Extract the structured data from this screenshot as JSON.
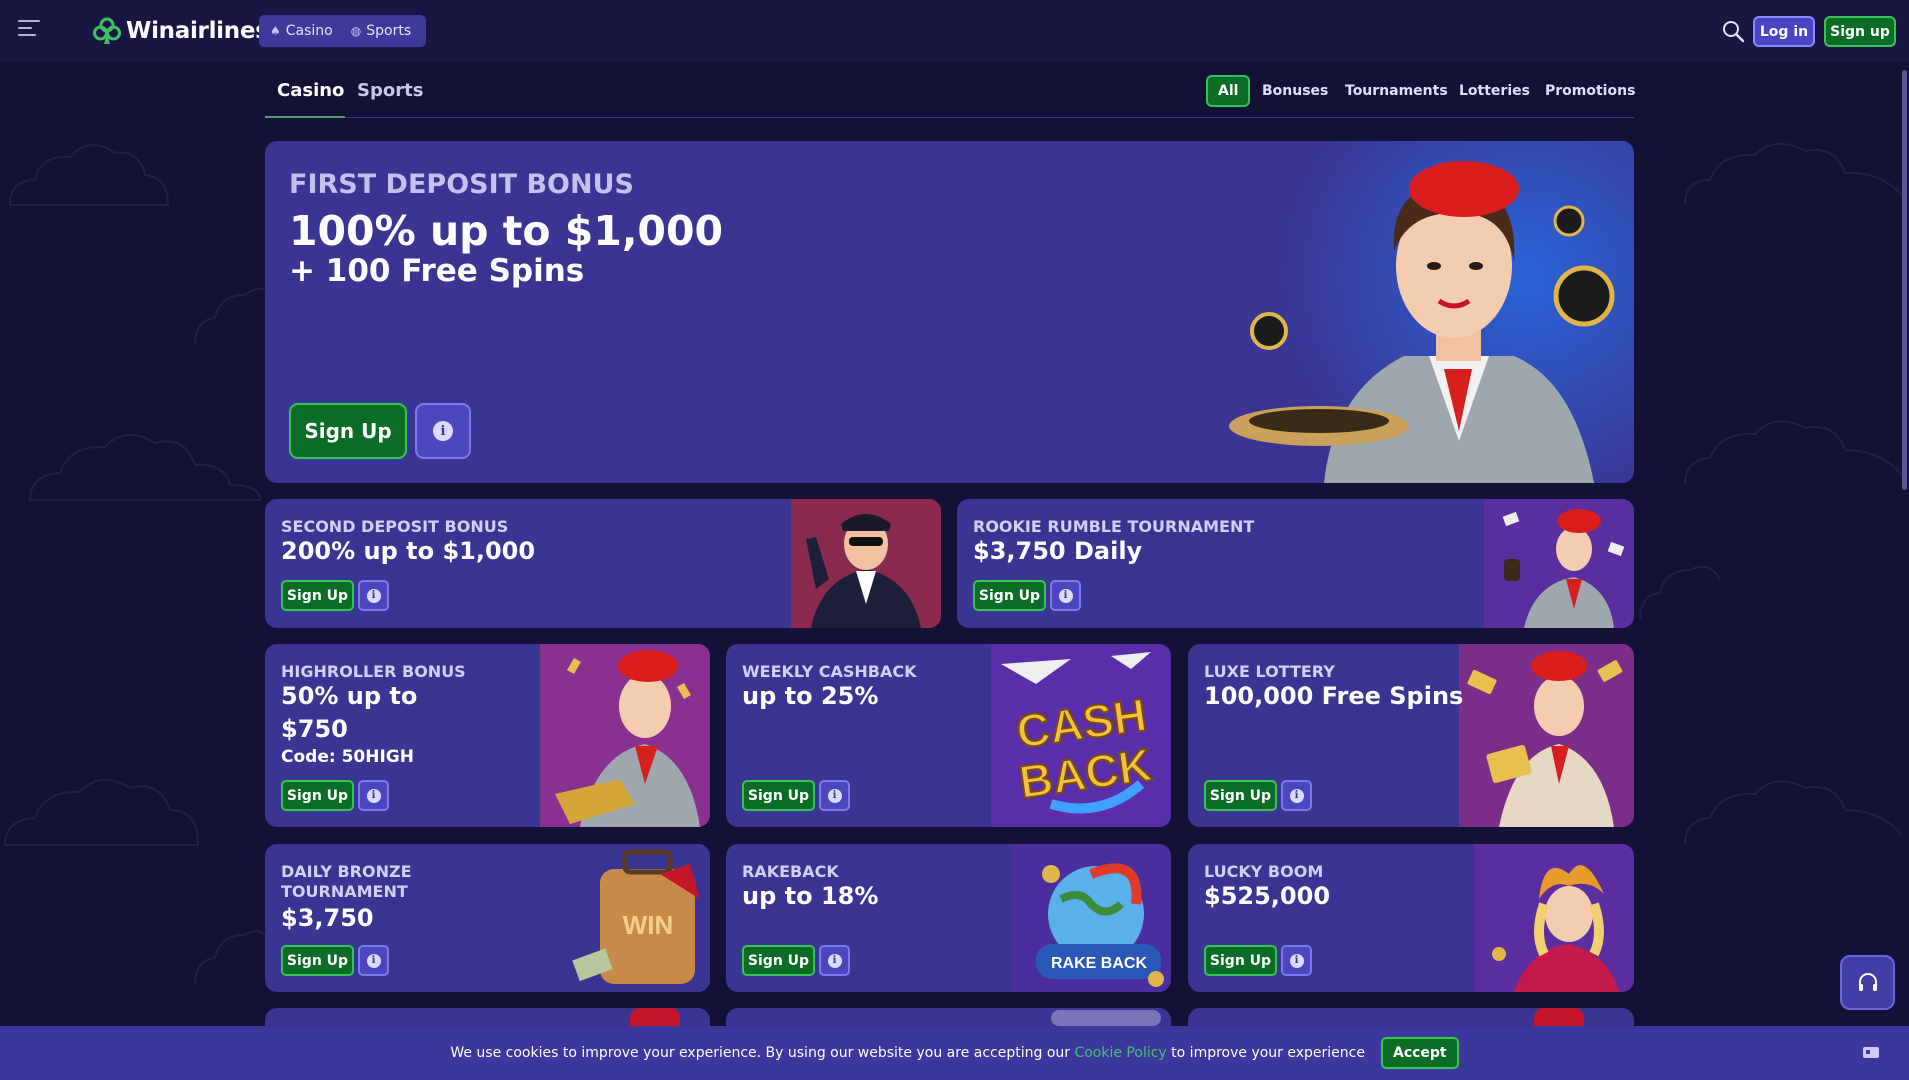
{
  "header": {
    "brand": "Winairlines",
    "modes": [
      {
        "label": "Casino",
        "icon": "spade-icon"
      },
      {
        "label": "Sports",
        "icon": "ball-icon"
      }
    ],
    "login_label": "Log in",
    "signup_label": "Sign up"
  },
  "tabs": {
    "main": [
      "Casino",
      "Sports"
    ],
    "active_main": "Casino",
    "filters": [
      "All",
      "Bonuses",
      "Tournaments",
      "Lotteries",
      "Promotions"
    ],
    "active_filter": "All"
  },
  "hero": {
    "kicker": "FIRST DEPOSIT BONUS",
    "line1": "100% up to $1,000",
    "line2": "+ 100 Free Spins",
    "cta": "Sign Up"
  },
  "cards": [
    {
      "kicker": "SECOND DEPOSIT BONUS",
      "headline": "200% up to $1,000",
      "cta": "Sign Up"
    },
    {
      "kicker": "ROOKIE RUMBLE TOURNAMENT",
      "headline": "$3,750 Daily",
      "cta": "Sign Up"
    },
    {
      "kicker": "HIGHROLLER BONUS",
      "headline1": "50% up to",
      "headline2": "$750",
      "code": "Code: 50HIGH",
      "cta": "Sign Up"
    },
    {
      "kicker": "WEEKLY CASHBACK",
      "headline": "up to 25%",
      "art_text1": "CASH",
      "art_text2": "BACK",
      "cta": "Sign Up"
    },
    {
      "kicker": "LUXE LOTTERY",
      "headline": "100,000 Free Spins",
      "cta": "Sign Up"
    },
    {
      "kicker1": "DAILY BRONZE",
      "kicker2": "TOURNAMENT",
      "headline": "$3,750",
      "art_text": "WIN",
      "cta": "Sign Up"
    },
    {
      "kicker": "RAKEBACK",
      "headline": "up to 18%",
      "art_text": "RAKE BACK",
      "cta": "Sign Up"
    },
    {
      "kicker": "LUCKY BOOM",
      "headline": "$525,000",
      "cta": "Sign Up"
    }
  ],
  "cookie": {
    "text_before": "We use cookies to improve your experience. By using our website you are accepting our",
    "link": "Cookie Policy",
    "text_after": "to improve your experience",
    "accept": "Accept"
  },
  "colors": {
    "background": "#141136",
    "header": "#191644",
    "card": "#3a3592",
    "green_button": "#0b6d25",
    "green_border": "#38c25a",
    "accent_blue": "#4a43c4"
  }
}
